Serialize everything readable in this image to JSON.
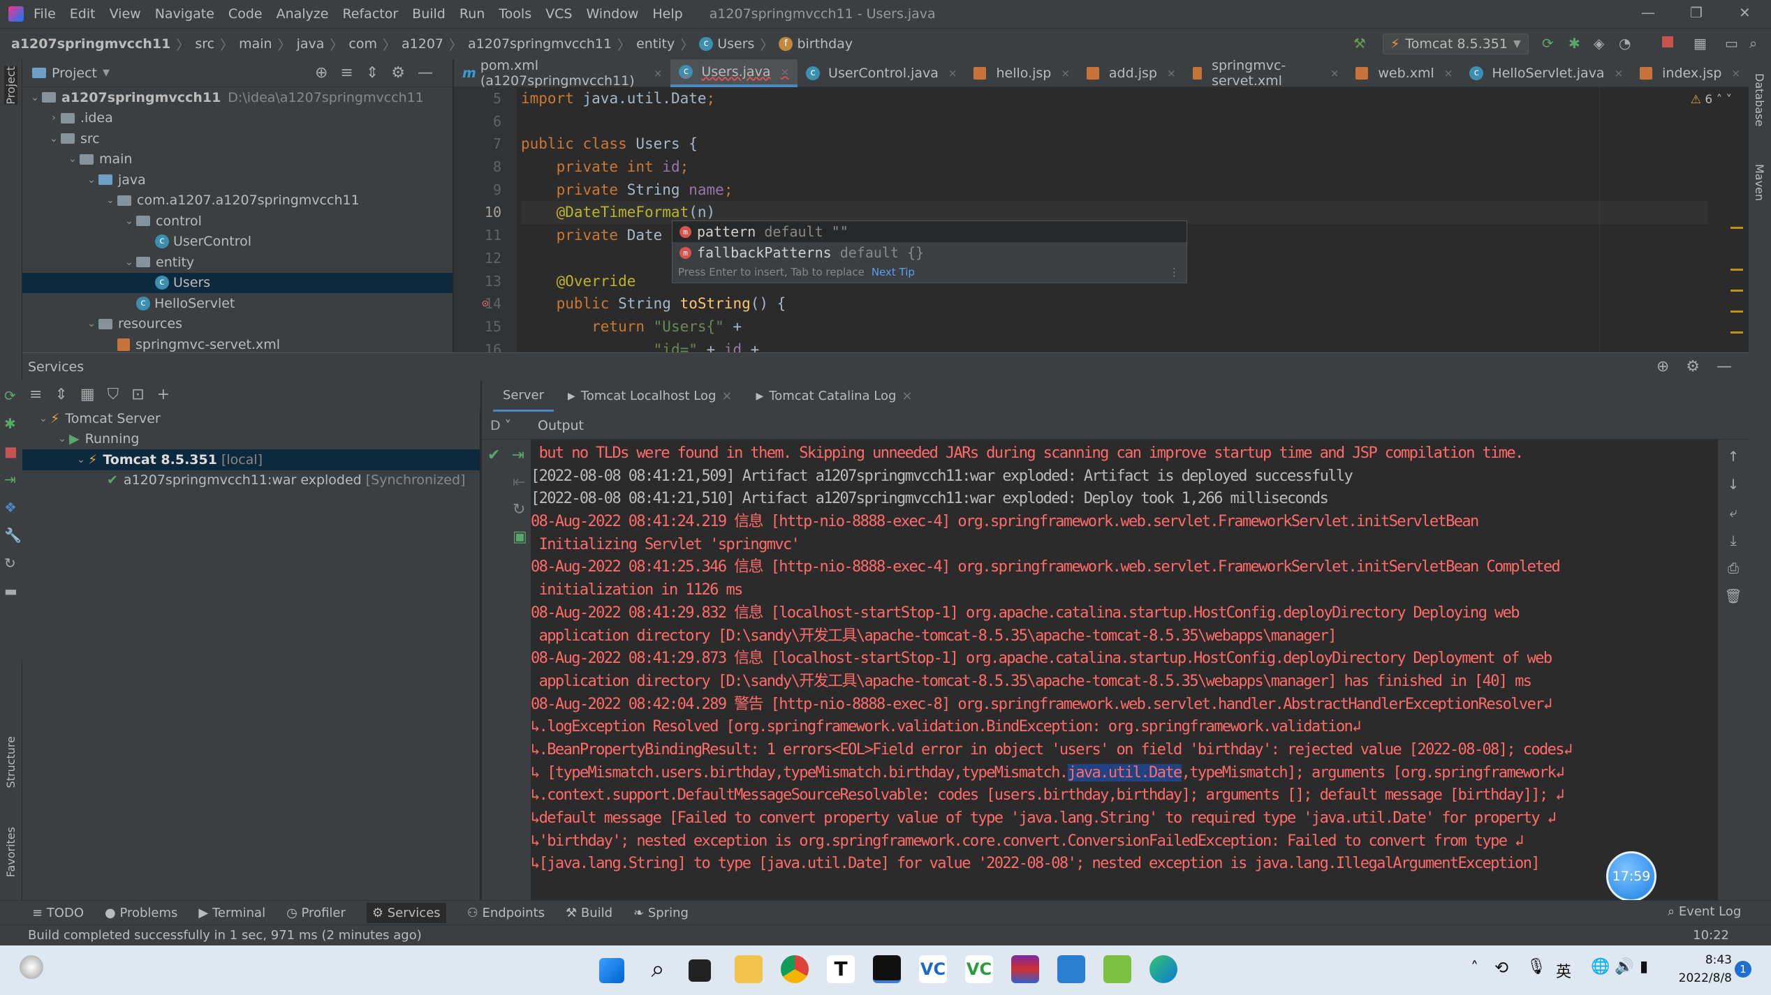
{
  "window": {
    "title": "a1207springmvcch11 - Users.java",
    "menu": [
      "File",
      "Edit",
      "View",
      "Navigate",
      "Code",
      "Analyze",
      "Refactor",
      "Build",
      "Run",
      "Tools",
      "VCS",
      "Window",
      "Help"
    ]
  },
  "breadcrumb": [
    "a1207springmvcch11",
    "src",
    "main",
    "java",
    "com",
    "a1207",
    "a1207springmvcch11",
    "entity",
    "Users",
    "birthday"
  ],
  "toolbar": {
    "run_config": "Tomcat 8.5.351"
  },
  "left_strip": {
    "project": "Project",
    "structure": "Structure",
    "favorites": "Favorites"
  },
  "right_strip": {
    "database": "Database",
    "maven": "Maven"
  },
  "project": {
    "header": "Project",
    "tree": [
      {
        "label": "a1207springmvcch11",
        "hint": "D:\\idea\\a1207springmvcch11",
        "level": 0,
        "icon": "folder",
        "open": true,
        "bold": true
      },
      {
        "label": ".idea",
        "level": 1,
        "icon": "folder",
        "open": false
      },
      {
        "label": "src",
        "level": 1,
        "icon": "folder",
        "open": true
      },
      {
        "label": "main",
        "level": 2,
        "icon": "folder",
        "open": true
      },
      {
        "label": "java",
        "level": 3,
        "icon": "folder-blue",
        "open": true
      },
      {
        "label": "com.a1207.a1207springmvcch11",
        "level": 4,
        "icon": "folder",
        "open": true
      },
      {
        "label": "control",
        "level": 5,
        "icon": "folder",
        "open": true
      },
      {
        "label": "UserControl",
        "level": 6,
        "icon": "class"
      },
      {
        "label": "entity",
        "level": 5,
        "icon": "folder",
        "open": true
      },
      {
        "label": "Users",
        "level": 6,
        "icon": "class",
        "selected": true
      },
      {
        "label": "HelloServlet",
        "level": 5,
        "icon": "class"
      },
      {
        "label": "resources",
        "level": 3,
        "icon": "folder",
        "open": true
      },
      {
        "label": "springmvc-servet.xml",
        "level": 4,
        "icon": "xml"
      }
    ]
  },
  "editor": {
    "tabs": [
      {
        "label": "pom.xml (a1207springmvcch11)",
        "icon": "maven"
      },
      {
        "label": "Users.java",
        "icon": "class",
        "active": true
      },
      {
        "label": "UserControl.java",
        "icon": "class"
      },
      {
        "label": "hello.jsp",
        "icon": "jsp"
      },
      {
        "label": "add.jsp",
        "icon": "jsp"
      },
      {
        "label": "springmvc-servet.xml",
        "icon": "xml"
      },
      {
        "label": "web.xml",
        "icon": "xml"
      },
      {
        "label": "HelloServlet.java",
        "icon": "class"
      },
      {
        "label": "index.jsp",
        "icon": "jsp"
      }
    ],
    "warnings": "6",
    "lines": [
      {
        "n": "5",
        "t": [
          [
            "import ",
            "kw"
          ],
          [
            "java.util.Date",
            "pl"
          ],
          [
            ";",
            "kw"
          ]
        ]
      },
      {
        "n": "6",
        "t": []
      },
      {
        "n": "7",
        "t": [
          [
            "public class ",
            "kw"
          ],
          [
            "Users {",
            "pl"
          ]
        ]
      },
      {
        "n": "8",
        "t": [
          [
            "    private int ",
            "kw"
          ],
          [
            "id",
            "fld"
          ],
          [
            ";",
            "kw"
          ]
        ]
      },
      {
        "n": "9",
        "t": [
          [
            "    private ",
            "kw"
          ],
          [
            "String ",
            "pl"
          ],
          [
            "name",
            "fld"
          ],
          [
            ";",
            "kw"
          ]
        ]
      },
      {
        "n": "10",
        "t": [
          [
            "    @DateTimeFormat",
            "ann"
          ],
          [
            "(n)",
            "pl"
          ]
        ],
        "current": true
      },
      {
        "n": "11",
        "t": [
          [
            "    private ",
            "kw"
          ],
          [
            "Date",
            "pl"
          ]
        ]
      },
      {
        "n": "12",
        "t": []
      },
      {
        "n": "13",
        "t": [
          [
            "    @Override",
            "ann"
          ]
        ]
      },
      {
        "n": "14",
        "t": [
          [
            "    public ",
            "kw"
          ],
          [
            "String ",
            "pl"
          ],
          [
            "toString",
            "fn"
          ],
          [
            "() {",
            "pl"
          ]
        ]
      },
      {
        "n": "15",
        "t": [
          [
            "        return ",
            "kw"
          ],
          [
            "\"Users{\"",
            "str"
          ],
          [
            " +",
            "pl"
          ]
        ]
      },
      {
        "n": "16",
        "t": [
          [
            "               ",
            "pl"
          ],
          [
            "\"id=\"",
            "str"
          ],
          [
            " + ",
            "pl"
          ],
          [
            "id",
            "fld"
          ],
          [
            " +",
            "pl"
          ]
        ]
      }
    ],
    "completion": {
      "items": [
        {
          "name": "pattern",
          "detail": "default \"\""
        },
        {
          "name": "fallbackPatterns",
          "detail": "default {}"
        }
      ],
      "footer": "Press Enter to insert, Tab to replace",
      "next_tip": "Next Tip"
    }
  },
  "services": {
    "title": "Services",
    "tree": [
      {
        "label": "Tomcat Server",
        "level": 0
      },
      {
        "label": "Running",
        "level": 1
      },
      {
        "label": "Tomcat 8.5.351",
        "suffix": "[local]",
        "level": 2,
        "selected": true
      },
      {
        "label": "a1207springmvcch11:war exploded",
        "suffix": "[Synchronized]",
        "level": 3
      }
    ],
    "output_tabs": [
      "Server",
      "Tomcat Localhost Log",
      "Tomcat Catalina Log"
    ],
    "output_label": "Output",
    "deploy_label": "D",
    "console": [
      {
        "c": "err",
        "t": " but no TLDs were found in them. Skipping unneeded JARs during scanning can improve startup time and JSP compilation time."
      },
      {
        "c": "info",
        "t": "[2022-08-08 08:41:21,509] Artifact a1207springmvcch11:war exploded: Artifact is deployed successfully"
      },
      {
        "c": "info",
        "t": "[2022-08-08 08:41:21,510] Artifact a1207springmvcch11:war exploded: Deploy took 1,266 milliseconds"
      },
      {
        "c": "err",
        "t": "08-Aug-2022 08:41:24.219 信息 [http-nio-8888-exec-4] org.springframework.web.servlet.FrameworkServlet.initServletBean"
      },
      {
        "c": "err",
        "t": " Initializing Servlet 'springmvc'"
      },
      {
        "c": "err",
        "t": "08-Aug-2022 08:41:25.346 信息 [http-nio-8888-exec-4] org.springframework.web.servlet.FrameworkServlet.initServletBean Completed"
      },
      {
        "c": "err",
        "t": " initialization in 1126 ms"
      },
      {
        "c": "err",
        "t": "08-Aug-2022 08:41:29.832 信息 [localhost-startStop-1] org.apache.catalina.startup.HostConfig.deployDirectory Deploying web"
      },
      {
        "c": "err",
        "t": " application directory [D:\\sandy\\开发工具\\apache-tomcat-8.5.35\\apache-tomcat-8.5.35\\webapps\\manager]"
      },
      {
        "c": "err",
        "t": "08-Aug-2022 08:41:29.873 信息 [localhost-startStop-1] org.apache.catalina.startup.HostConfig.deployDirectory Deployment of web"
      },
      {
        "c": "err",
        "t": " application directory [D:\\sandy\\开发工具\\apache-tomcat-8.5.35\\apache-tomcat-8.5.35\\webapps\\manager] has finished in [40] ms"
      },
      {
        "c": "err",
        "t": "08-Aug-2022 08:42:04.289 警告 [http-nio-8888-exec-8] org.springframework.web.servlet.handler.AbstractHandlerExceptionResolver↲"
      },
      {
        "c": "err",
        "t": "↳.logException Resolved [org.springframework.validation.BindException: org.springframework.validation↲"
      },
      {
        "c": "err",
        "t": "↳.BeanPropertyBindingResult: 1 errors<EOL>Field error in object 'users' on field 'birthday': rejected value [2022-08-08]; codes↲"
      },
      {
        "c": "err",
        "t": "↳ [typeMismatch.users.birthday,typeMismatch.birthday,typeMismatch.java.util.Date,typeMismatch]; arguments [org.springframework↲",
        "highlight": "java.util.Date"
      },
      {
        "c": "err",
        "t": "↳.context.support.DefaultMessageSourceResolvable: codes [users.birthday,birthday]; arguments []; default message [birthday]]; ↲"
      },
      {
        "c": "err",
        "t": "↳default message [Failed to convert property value of type 'java.lang.String' to required type 'java.util.Date' for property ↲"
      },
      {
        "c": "err",
        "t": "↳'birthday'; nested exception is org.springframework.core.convert.ConversionFailedException: Failed to convert from type ↲"
      },
      {
        "c": "err",
        "t": "↳[java.lang.String] to type [java.util.Date] for value '2022-08-08'; nested exception is java.lang.IllegalArgumentException]"
      }
    ]
  },
  "timer": "17:59",
  "tool_windows": [
    "TODO",
    "Problems",
    "Terminal",
    "Profiler",
    "Services",
    "Endpoints",
    "Build",
    "Spring"
  ],
  "event_log": "Event Log",
  "status": {
    "message": "Build completed successfully in 1 sec, 971 ms (2 minutes ago)",
    "position": "10:22"
  },
  "taskbar": {
    "time": "8:43",
    "date": "2022/8/8",
    "ime": "英",
    "notifications": "1"
  },
  "colors": {
    "error_text": "#ff6b68",
    "selection": "#214283",
    "accent": "#4a88c7"
  }
}
